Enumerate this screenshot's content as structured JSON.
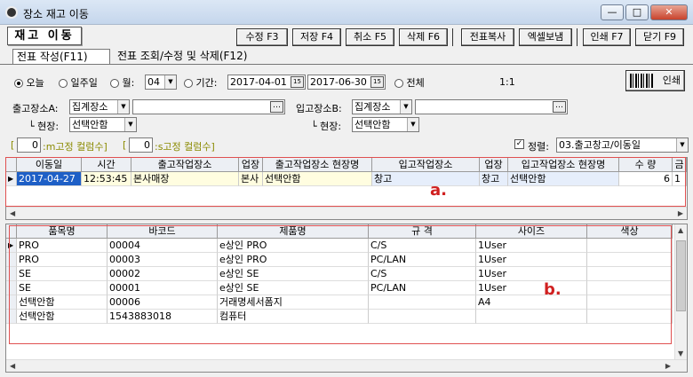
{
  "window": {
    "title": "장소 재고 이동",
    "min": "—",
    "max": "□",
    "close": "✕"
  },
  "heading": "재고 이동",
  "toolbar": {
    "edit": "수정 F3",
    "save": "저장 F4",
    "cancel": "취소 F5",
    "delete": "삭제 F6",
    "copy": "전표복사",
    "excel": "엑셀보냄",
    "print": "인쇄 F7",
    "close": "닫기 F9"
  },
  "tabs": [
    "전표 작성(F11)",
    "전표 조회/수정 및 삭제(F12)"
  ],
  "filters": {
    "today": "오늘",
    "week": "일주일",
    "month": "월:",
    "month_value": "04",
    "period": "기간:",
    "date_from": "2017-04-01",
    "date_to": "2017-06-30",
    "all": "전체",
    "page_info": "1:1",
    "print_label": "인쇄"
  },
  "outgoing": {
    "label": "출고장소A:",
    "type": "집계장소",
    "site_label": "└ 현장:",
    "site_value": "선택안함"
  },
  "incoming": {
    "label": "입고장소B:",
    "type": "집계장소",
    "site_label": "└ 현장:",
    "site_value": "선택안함"
  },
  "fixed_cols": {
    "m_value": "0",
    "m_label": ":m고정 컬럼수]",
    "s_value": "0",
    "s_label": ":s고정 컬럼수]",
    "open_bracket": "["
  },
  "sort": {
    "label": "정렬:",
    "value": "03.출고창고/이동일"
  },
  "grid_a": {
    "headers": [
      "이동일",
      "시간",
      "출고작업장소",
      "업장",
      "출고작업장소 현장명",
      "입고작업장소",
      "업장",
      "입고작업장소 현장명",
      "수 량",
      "금"
    ],
    "row": [
      "2017-04-27",
      "12:53:45",
      "본사매장",
      "본사",
      "선택안함",
      "창고",
      "창고",
      "선택안함",
      "6",
      "1"
    ],
    "marker": "a."
  },
  "grid_b": {
    "headers": [
      "품목명",
      "바코드",
      "제품명",
      "규 격",
      "사이즈",
      "색상"
    ],
    "rows": [
      [
        "PRO",
        "00004",
        "e상인 PRO",
        "C/S",
        "1User",
        ""
      ],
      [
        "PRO",
        "00003",
        "e상인 PRO",
        "PC/LAN",
        "1User",
        ""
      ],
      [
        "SE",
        "00002",
        "e상인 SE",
        "C/S",
        "1User",
        ""
      ],
      [
        "SE",
        "00001",
        "e상인 SE",
        "PC/LAN",
        "1User",
        ""
      ],
      [
        "선택안함",
        "00006",
        "거래명세서폼지",
        "",
        "A4",
        ""
      ],
      [
        "선택안함",
        "1543883018",
        "컴퓨터",
        "",
        "",
        ""
      ]
    ],
    "marker": "b."
  }
}
